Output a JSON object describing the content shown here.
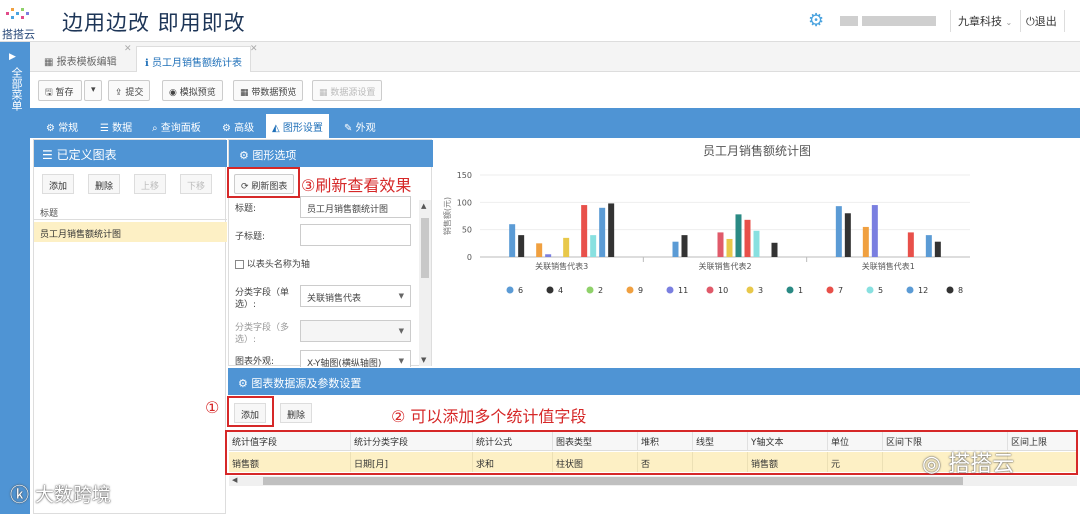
{
  "app": {
    "brand": "搭搭云",
    "slogan": "边用边改 即用即改",
    "company": "九章科技",
    "logout": "退出"
  },
  "sidebar": {
    "label": "全部菜单"
  },
  "tabs": [
    {
      "label": "报表模板编辑"
    },
    {
      "label": "员工月销售额统计表"
    }
  ],
  "toolbar": {
    "save": "暂存",
    "submit": "提交",
    "mock_preview": "模拟预览",
    "data_preview": "带数据预览",
    "datasource": "数据源设置"
  },
  "settings_tabs": [
    {
      "label": "常规"
    },
    {
      "label": "数据"
    },
    {
      "label": "查询面板"
    },
    {
      "label": "高级"
    },
    {
      "label": "图形设置"
    },
    {
      "label": "外观"
    }
  ],
  "left_panel": {
    "title": "已定义图表",
    "add": "添加",
    "delete": "删除",
    "up": "上移",
    "down": "下移",
    "column": "标题",
    "rows": [
      "员工月销售额统计图"
    ]
  },
  "graph_options": {
    "title": "图形选项",
    "refresh": "刷新图表",
    "title_label": "标题:",
    "title_value": "员工月销售额统计图",
    "subtitle_label": "子标题:",
    "header_axis": "以表头名称为轴",
    "category_label": "分类字段（单选）:",
    "category_value": "关联销售代表",
    "category_multi_label": "分类字段（多选）:",
    "appearance_label": "图表外观:",
    "appearance_value": "X-Y轴图(横纵轴图)"
  },
  "annotations": {
    "a1": "①",
    "a2": "② 可以添加多个统计值字段",
    "a3": "③刷新查看效果"
  },
  "bottom": {
    "title": "图表数据源及参数设置",
    "add": "添加",
    "delete": "删除",
    "headers": [
      "统计值字段",
      "统计分类字段",
      "统计公式",
      "图表类型",
      "堆积",
      "线型",
      "Y轴文本",
      "单位",
      "区间下限",
      "区间上限"
    ],
    "row": [
      "销售额",
      "日期[月]",
      "求和",
      "柱状图",
      "否",
      "",
      "销售额",
      "元",
      "",
      ""
    ]
  },
  "watermarks": {
    "left": "大数跨境",
    "right": "搭搭云"
  },
  "colors": {
    "blue": "#4f94d4",
    "highlight": "#fdf0c5",
    "annotation": "#d62828"
  },
  "chart_data": {
    "type": "bar",
    "title": "员工月销售额统计图",
    "ylabel": "销售额(元)",
    "ylim": [
      0,
      150
    ],
    "yticks": [
      0,
      50,
      100,
      150
    ],
    "categories": [
      "关联销售代表3",
      "关联销售代表2",
      "关联销售代表1"
    ],
    "legend_position": "bottom",
    "series": [
      {
        "name": "6",
        "color": "#5b9bd5",
        "values": [
          60,
          28,
          93
        ]
      },
      {
        "name": "4",
        "color": "#333333",
        "values": [
          40,
          40,
          80
        ]
      },
      {
        "name": "2",
        "color": "#8fd16a",
        "values": [
          0,
          0,
          0
        ]
      },
      {
        "name": "9",
        "color": "#f0a040",
        "values": [
          25,
          0,
          55
        ]
      },
      {
        "name": "11",
        "color": "#7a7fe0",
        "values": [
          5,
          0,
          95
        ]
      },
      {
        "name": "10",
        "color": "#e05a6a",
        "values": [
          0,
          45,
          0
        ]
      },
      {
        "name": "3",
        "color": "#e8c84a",
        "values": [
          35,
          33,
          0
        ]
      },
      {
        "name": "1",
        "color": "#2a8a84",
        "values": [
          0,
          78,
          0
        ]
      },
      {
        "name": "7",
        "color": "#e8504a",
        "values": [
          95,
          68,
          45
        ]
      },
      {
        "name": "5",
        "color": "#88e0e0",
        "values": [
          40,
          48,
          0
        ]
      },
      {
        "name": "12",
        "color": "#5b9bd5",
        "values": [
          90,
          0,
          40
        ]
      },
      {
        "name": "8",
        "color": "#333333",
        "values": [
          98,
          26,
          28
        ]
      }
    ]
  }
}
